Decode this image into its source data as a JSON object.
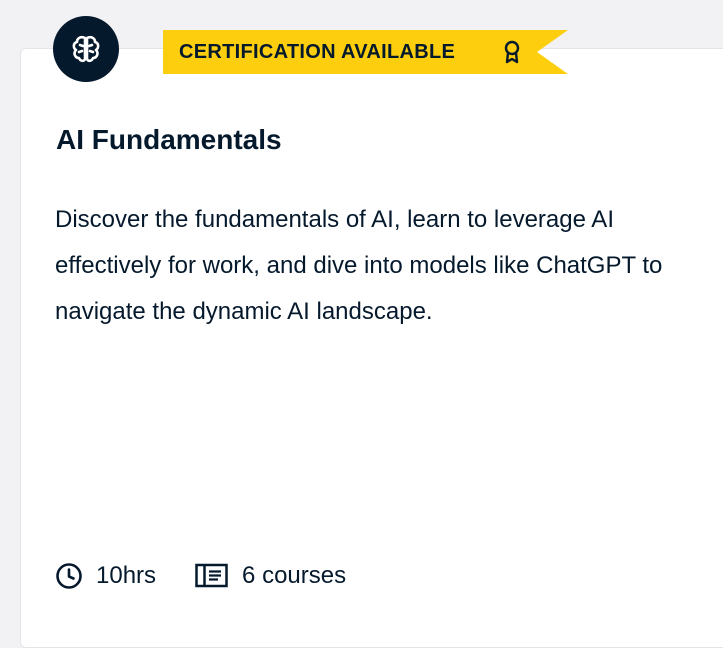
{
  "card": {
    "icon": "brain-icon",
    "badge": {
      "label": "CERTIFICATION AVAILABLE",
      "icon": "award-icon",
      "color": "#fcce0d"
    },
    "title": "AI Fundamentals",
    "description": "Discover the fundamentals of AI, learn to leverage AI effectively for work, and dive into models like ChatGPT to navigate the dynamic AI landscape.",
    "duration": {
      "icon": "clock-icon",
      "value": "10hrs"
    },
    "courses": {
      "icon": "courses-icon",
      "value": "6 courses"
    }
  },
  "colors": {
    "text": "#05192d",
    "icon_background": "#05192d",
    "badge": "#fcce0d",
    "card_background": "#ffffff",
    "page_background": "#f2f2f4"
  }
}
